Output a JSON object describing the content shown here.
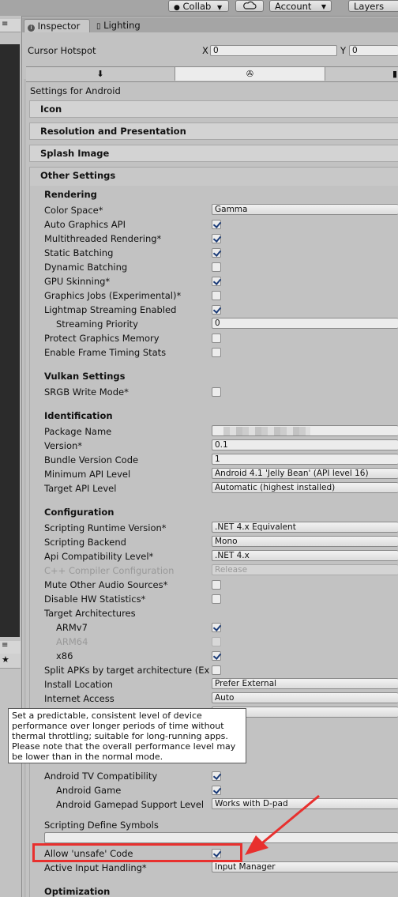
{
  "toolbar": {
    "collab_label": "Collab",
    "cloud_icon": "cloud-icon",
    "account_label": "Account",
    "layers_label": "Layers"
  },
  "left_panel": {
    "tab_glyph": "≡",
    "bottom_tab_glyph": "≡",
    "star_glyph": "★"
  },
  "tabs": [
    {
      "label": "Inspector",
      "icon": "info-icon"
    },
    {
      "label": "Lighting",
      "icon": "lighting-icon"
    }
  ],
  "cursor_hotspot": {
    "label": "Cursor Hotspot",
    "x_label": "X",
    "x_value": "0",
    "y_label": "Y",
    "y_value": "0"
  },
  "platform_tabs": [
    {
      "icon": "download-icon",
      "glyph": "⬇"
    },
    {
      "icon": "android-icon",
      "glyph": "✇"
    },
    {
      "icon": "monitor-icon",
      "glyph": "▮"
    }
  ],
  "settings_for": "Settings for Android",
  "foldouts": {
    "icon": "Icon",
    "resolution": "Resolution and Presentation",
    "splash": "Splash Image",
    "other": "Other Settings"
  },
  "rendering": {
    "title": "Rendering",
    "color_space": {
      "label": "Color Space*",
      "value": "Gamma"
    },
    "auto_graphics_api": {
      "label": "Auto Graphics API",
      "checked": true
    },
    "multithreaded": {
      "label": "Multithreaded Rendering*",
      "checked": true
    },
    "static_batching": {
      "label": "Static Batching",
      "checked": true
    },
    "dynamic_batching": {
      "label": "Dynamic Batching",
      "checked": false
    },
    "gpu_skinning": {
      "label": "GPU Skinning*",
      "checked": true
    },
    "graphics_jobs": {
      "label": "Graphics Jobs (Experimental)*",
      "checked": false
    },
    "lightmap_streaming": {
      "label": "Lightmap Streaming Enabled",
      "checked": true
    },
    "streaming_priority": {
      "label": "Streaming Priority",
      "value": "0"
    },
    "protect_graphics_memory": {
      "label": "Protect Graphics Memory",
      "checked": false
    },
    "frame_timing": {
      "label": "Enable Frame Timing Stats",
      "checked": false
    }
  },
  "vulkan": {
    "title": "Vulkan Settings",
    "srgb": {
      "label": "SRGB Write Mode*",
      "checked": false
    }
  },
  "identification": {
    "title": "Identification",
    "package_name": {
      "label": "Package Name"
    },
    "version": {
      "label": "Version*",
      "value": "0.1"
    },
    "bundle_version_code": {
      "label": "Bundle Version Code",
      "value": "1"
    },
    "min_api": {
      "label": "Minimum API Level",
      "value": "Android 4.1 'Jelly Bean' (API level 16)"
    },
    "target_api": {
      "label": "Target API Level",
      "value": "Automatic (highest installed)"
    }
  },
  "configuration": {
    "title": "Configuration",
    "scripting_runtime": {
      "label": "Scripting Runtime Version*",
      "value": ".NET 4.x Equivalent"
    },
    "scripting_backend": {
      "label": "Scripting Backend",
      "value": "Mono"
    },
    "api_compat": {
      "label": "Api Compatibility Level*",
      "value": ".NET 4.x"
    },
    "cpp_compiler": {
      "label": "C++ Compiler Configuration",
      "value": "Release"
    },
    "mute_audio": {
      "label": "Mute Other Audio Sources*",
      "checked": false
    },
    "disable_hw_stats": {
      "label": "Disable HW Statistics*",
      "checked": false
    },
    "target_arch": {
      "label": "Target Architectures"
    },
    "armv7": {
      "label": "ARMv7",
      "checked": true
    },
    "arm64": {
      "label": "ARM64",
      "checked": false
    },
    "x86": {
      "label": "x86",
      "checked": true
    },
    "split_apks": {
      "label": "Split APKs by target architecture (Ex",
      "checked": false
    },
    "install_location": {
      "label": "Install Location",
      "value": "Prefer External"
    },
    "internet_access": {
      "label": "Internet Access",
      "value": "Auto"
    },
    "android_tv": {
      "label": "Android TV Compatibility",
      "checked": true
    },
    "android_game": {
      "label": "Android Game",
      "checked": true
    },
    "gamepad_support": {
      "label": "Android Gamepad Support Level",
      "value": "Works with D-pad"
    },
    "scripting_define": {
      "label": "Scripting Define Symbols"
    },
    "allow_unsafe": {
      "label": "Allow 'unsafe' Code",
      "checked": true
    },
    "active_input": {
      "label": "Active Input Handling*",
      "value": "Input Manager"
    }
  },
  "tooltip": "Set a predictable, consistent level of device performance over longer periods of time without thermal throttling; suitable for long-running apps. Please note that the overall performance level may be lower than in the normal mode.",
  "optimization": {
    "title": "Optimization"
  },
  "colors": {
    "highlight_box": "#e8302e",
    "arrow": "#e8302e"
  }
}
